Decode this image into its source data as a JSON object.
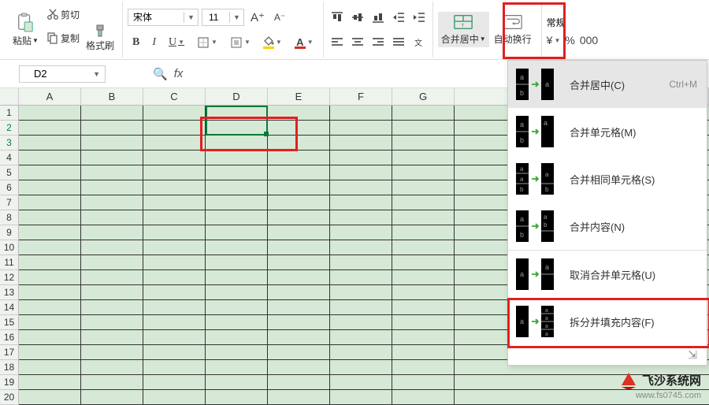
{
  "ribbon": {
    "paste": "粘贴",
    "cut": "剪切",
    "copy": "复制",
    "format_painter": "格式刷",
    "font": "宋体",
    "font_size": "11",
    "merge_center": "合并居中",
    "wrap_text": "自动换行",
    "number_format": "常规"
  },
  "name_box": "D2",
  "columns": [
    "A",
    "B",
    "C",
    "D",
    "E",
    "F",
    "G"
  ],
  "rows": [
    "1",
    "2",
    "3",
    "4",
    "5",
    "6",
    "7",
    "8",
    "9",
    "10",
    "11",
    "12",
    "13",
    "14",
    "15",
    "16",
    "17",
    "18",
    "19",
    "20"
  ],
  "dropdown": {
    "items": [
      {
        "icon": "merge-center",
        "label": "合并居中(C)",
        "shortcut": "Ctrl+M"
      },
      {
        "icon": "merge-cells",
        "label": "合并单元格(M)",
        "shortcut": ""
      },
      {
        "icon": "merge-same",
        "label": "合并相同单元格(S)",
        "shortcut": ""
      },
      {
        "icon": "merge-content",
        "label": "合并内容(N)",
        "shortcut": ""
      },
      {
        "icon": "unmerge",
        "label": "取消合并单元格(U)",
        "shortcut": ""
      },
      {
        "icon": "split-fill",
        "label": "拆分并填充内容(F)",
        "shortcut": ""
      }
    ]
  },
  "watermark": {
    "text": "飞沙系统网",
    "url": "www.fs0745.com"
  }
}
